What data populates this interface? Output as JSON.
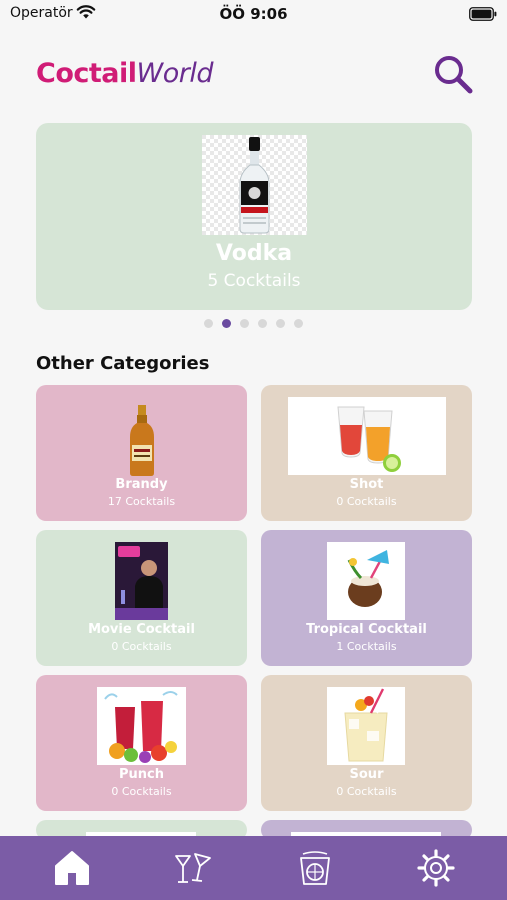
{
  "status_bar": {
    "carrier": "Operatör",
    "time": "ÖÖ 9:06"
  },
  "header": {
    "logo_part1": "Coctail",
    "logo_part2": "World"
  },
  "featured": {
    "title": "Vodka",
    "subtitle": "5 Cocktails"
  },
  "carousel": {
    "count": 6,
    "active_index": 1
  },
  "section_title": "Other Categories",
  "categories": [
    {
      "name": "Brandy",
      "count": "17 Cocktails",
      "color": "#e2b7c9"
    },
    {
      "name": "Shot",
      "count": "0 Cocktails",
      "color": "#e3d5c6"
    },
    {
      "name": "Movie Cocktail",
      "count": "0 Cocktails",
      "color": "#d6e5d6"
    },
    {
      "name": "Tropical Cocktail",
      "count": "1 Cocktails",
      "color": "#c2b3d3"
    },
    {
      "name": "Punch",
      "count": "0 Cocktails",
      "color": "#e2b7c9"
    },
    {
      "name": "Sour",
      "count": "0 Cocktails",
      "color": "#e3d5c6"
    }
  ],
  "colors": {
    "accent": "#6a2c8f",
    "brand_pink": "#d01c76",
    "tabbar": "#7b5ca6"
  },
  "tabs": [
    {
      "icon": "home-icon"
    },
    {
      "icon": "cocktail-glasses-icon"
    },
    {
      "icon": "lemon-glass-icon"
    },
    {
      "icon": "gear-icon"
    }
  ]
}
